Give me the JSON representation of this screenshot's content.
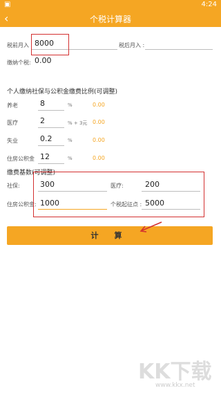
{
  "status": {
    "left_icon": "app-icon",
    "time": "4:24"
  },
  "appbar": {
    "title": "个税计算器",
    "back_icon": "chevron-left-icon"
  },
  "top": {
    "pre_tax_label": "税前月入",
    "pre_tax_value": "8000",
    "after_tax_label": "税后月入 :",
    "after_tax_value": "",
    "tax_label": "缴纳个税:",
    "tax_value": "0.00"
  },
  "ratio_section": {
    "title": "个人缴纳社保与公积金缴费比例(可调整)",
    "rows": [
      {
        "label": "养老",
        "value": "8",
        "unit": "%",
        "amount": "0.00"
      },
      {
        "label": "医疗",
        "value": "2",
        "unit": "% + 3元",
        "amount": "0.00"
      },
      {
        "label": "失业",
        "value": "0.2",
        "unit": "%",
        "amount": "0.00"
      },
      {
        "label": "住房公积金",
        "value": "12",
        "unit": "%",
        "amount": "0.00"
      }
    ]
  },
  "base_section": {
    "title": "缴费基数(可调整)",
    "social_label": "社保:",
    "social_value": "300",
    "medical_label": "医疗:",
    "medical_value": "200",
    "housing_label": "住房公积金:",
    "housing_value": "1000",
    "threshold_label": "个税起征点 :",
    "threshold_value": "5000"
  },
  "actions": {
    "calc_label": "计 算"
  },
  "colors": {
    "accent": "#f5a623",
    "highlight": "#d32f2f"
  },
  "watermark": {
    "big": "KK下载",
    "small": "www.kkx.net"
  }
}
